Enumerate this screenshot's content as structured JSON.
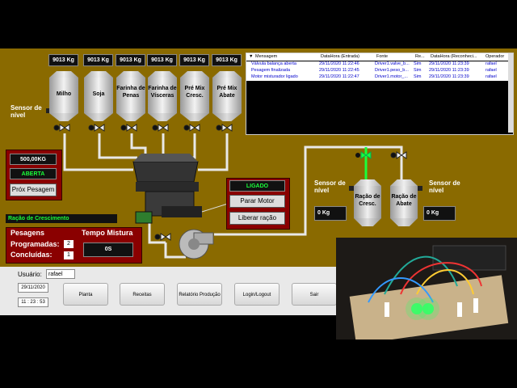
{
  "scada": {
    "silos": [
      {
        "weight": "9013 Kg",
        "name": "Milho"
      },
      {
        "weight": "9013 Kg",
        "name": "Soja"
      },
      {
        "weight": "9013 Kg",
        "name": "Farinha de Penas"
      },
      {
        "weight": "9013 Kg",
        "name": "Farinha de Vísceras"
      },
      {
        "weight": "9013 Kg",
        "name": "Pré Mix Cresc."
      },
      {
        "weight": "9013 Kg",
        "name": "Pré Mix Abate"
      }
    ],
    "level_sensor_left": "Sensor de nível",
    "scale": {
      "weight": "500,00KG",
      "status": "ABERTA",
      "next_button": "Próx Pesagem"
    },
    "mixer_panel": {
      "status": "LIGADO",
      "stop_button": "Parar Motor",
      "release_button": "Liberar ração"
    },
    "recipe_name": "Ração de Crescimento",
    "weighings": {
      "title": "Pesagens",
      "programmed_label": "Programadas:",
      "programmed_value": "2",
      "done_label": "Concluídas:",
      "done_value": "1"
    },
    "mix_time": {
      "title": "Tempo Mistura",
      "value": "0S"
    },
    "output_silos": [
      {
        "name": "Ração de Cresc.",
        "sensor_label": "Sensor de nível",
        "level": "0 Kg"
      },
      {
        "name": "Ração de Abate",
        "sensor_label": "Sensor de nível",
        "level": "0 Kg"
      }
    ],
    "colors": {
      "background": "#8a6a00",
      "accent_green": "#1aff3a",
      "status_red": "#8a0000"
    }
  },
  "alarms": {
    "headers": [
      "Mensagem",
      "DataHora (Entrada)",
      "Fonte",
      "Re...",
      "DataHora (Reconheci...",
      "Operador"
    ],
    "rows": [
      [
        "Válvula balança aberta",
        "29/11/2020 11:22:46",
        "Driver1.valve_b...",
        "Sim",
        "29/11/2020 11:23:39",
        "rafael"
      ],
      [
        "Pesagem finalizada",
        "29/11/2020 11:22:45",
        "Driver1.peso_b...",
        "Sim",
        "29/11/2020 11:23:39",
        "rafael"
      ],
      [
        "Motor misturador ligado",
        "29/11/2020 11:22:47",
        "Driver1.motor_...",
        "Sim",
        "29/11/2020 11:23:39",
        "rafael"
      ]
    ]
  },
  "footer": {
    "user_label": "Usuário:",
    "user_value": "rafael",
    "date": "29/11/2020",
    "time": "11 : 23 : 53",
    "nav": [
      "Planta",
      "Receitas",
      "Relatório Produção",
      "Login/Logout",
      "Sair"
    ]
  }
}
